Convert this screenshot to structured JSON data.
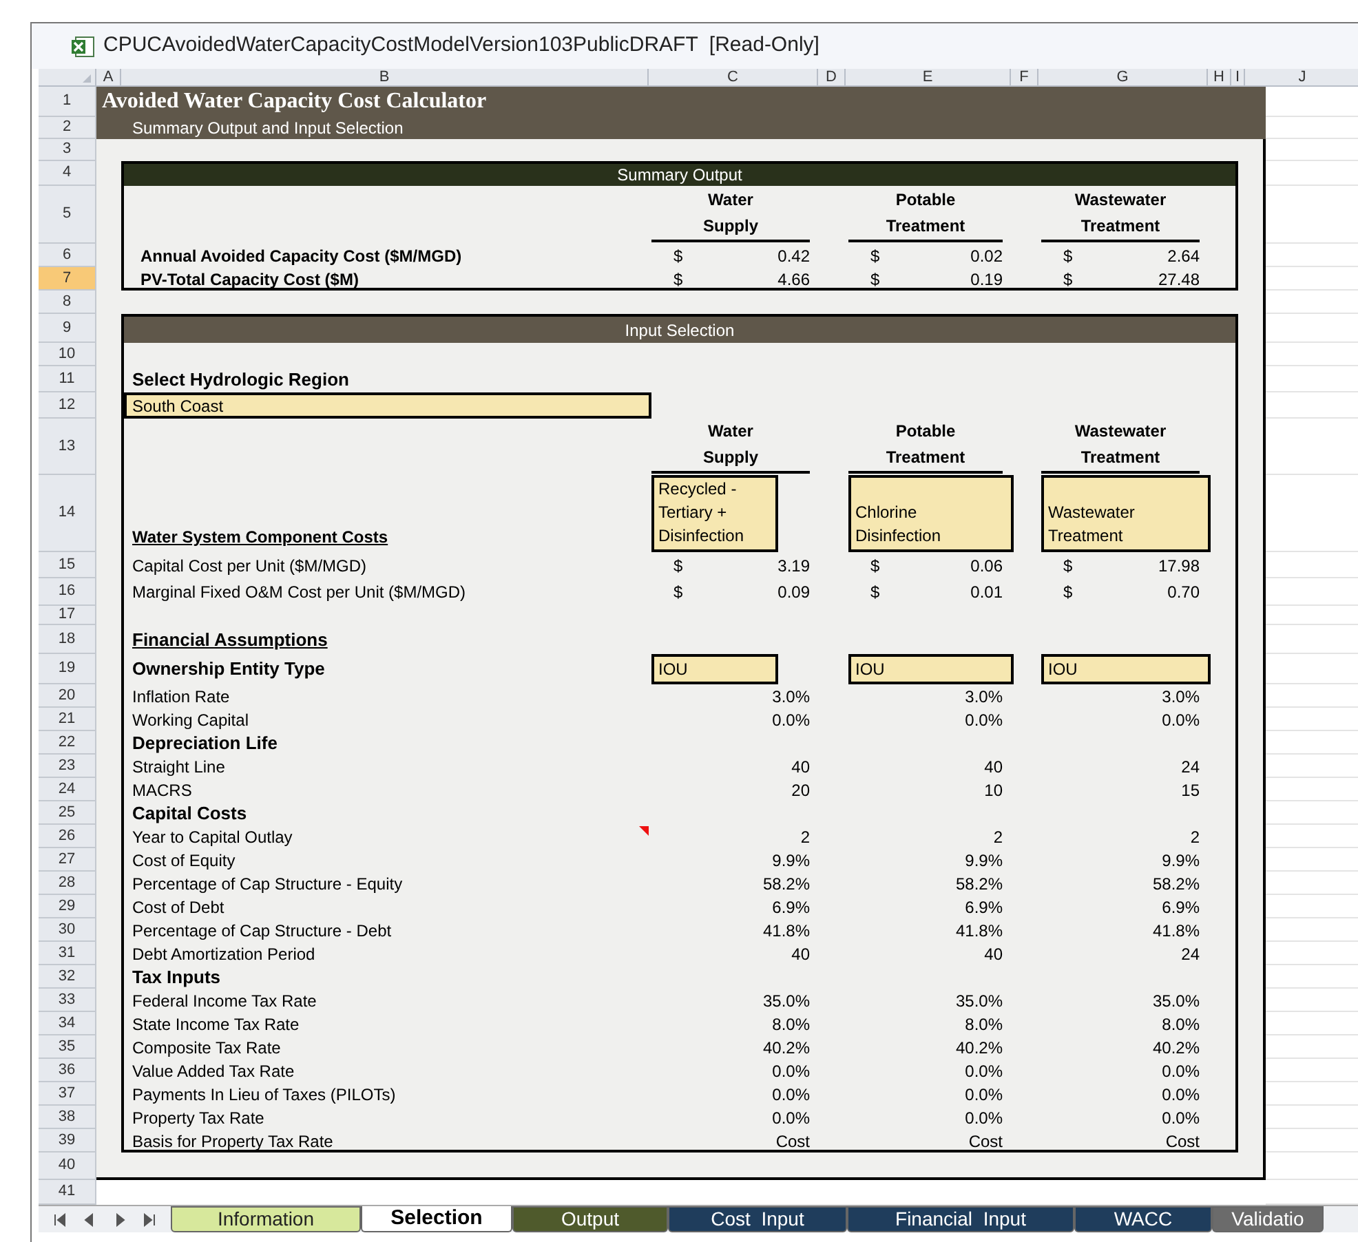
{
  "window": {
    "title": "CPUCAvoidedWaterCapacityCostModelVersion103PublicDRAFT  [Read-Only]"
  },
  "column_headers": [
    "A",
    "B",
    "C",
    "D",
    "E",
    "F",
    "G",
    "H",
    "I",
    "J"
  ],
  "row_headers": [
    {
      "label": "1",
      "selected": false
    },
    {
      "label": "2",
      "selected": false
    },
    {
      "label": "3",
      "selected": false
    },
    {
      "label": "4",
      "selected": false
    },
    {
      "label": "5",
      "selected": false
    },
    {
      "label": "6",
      "selected": false
    },
    {
      "label": "7",
      "selected": true
    },
    {
      "label": "8",
      "selected": false
    },
    {
      "label": "9",
      "selected": false
    },
    {
      "label": "10",
      "selected": false
    },
    {
      "label": "11",
      "selected": false
    },
    {
      "label": "12",
      "selected": false
    },
    {
      "label": "13",
      "selected": false
    },
    {
      "label": "14",
      "selected": false
    },
    {
      "label": "15",
      "selected": false
    },
    {
      "label": "16",
      "selected": false
    },
    {
      "label": "17",
      "selected": false
    },
    {
      "label": "18",
      "selected": false
    },
    {
      "label": "19",
      "selected": false
    },
    {
      "label": "20",
      "selected": false
    },
    {
      "label": "21",
      "selected": false
    },
    {
      "label": "22",
      "selected": false
    },
    {
      "label": "23",
      "selected": false
    },
    {
      "label": "24",
      "selected": false
    },
    {
      "label": "25",
      "selected": false
    },
    {
      "label": "26",
      "selected": false
    },
    {
      "label": "27",
      "selected": false
    },
    {
      "label": "28",
      "selected": false
    },
    {
      "label": "29",
      "selected": false
    },
    {
      "label": "30",
      "selected": false
    },
    {
      "label": "31",
      "selected": false
    },
    {
      "label": "32",
      "selected": false
    },
    {
      "label": "33",
      "selected": false
    },
    {
      "label": "34",
      "selected": false
    },
    {
      "label": "35",
      "selected": false
    },
    {
      "label": "36",
      "selected": false
    },
    {
      "label": "37",
      "selected": false
    },
    {
      "label": "38",
      "selected": false
    },
    {
      "label": "39",
      "selected": false
    },
    {
      "label": "40",
      "selected": false
    },
    {
      "label": "41",
      "selected": false
    }
  ],
  "sheet": {
    "title": "Avoided Water Capacity Cost Calculator",
    "subtitle": "Summary Output and Input Selection",
    "summary_output": {
      "title": "Summary Output",
      "column_headers": [
        {
          "line_1": "Water",
          "line_2": "Supply"
        },
        {
          "line_1": "Potable",
          "line_2": "Treatment"
        },
        {
          "line_1": "Wastewater",
          "line_2": "Treatment"
        }
      ],
      "rows": [
        {
          "label": "Annual Avoided Capacity Cost ($M/MGD)",
          "values": [
            {
              "currency": "$",
              "amount": "0.42"
            },
            {
              "currency": "$",
              "amount": "0.02"
            },
            {
              "currency": "$",
              "amount": "2.64"
            }
          ]
        },
        {
          "label": "PV-Total Capacity Cost ($M)",
          "values": [
            {
              "currency": "$",
              "amount": "4.66"
            },
            {
              "currency": "$",
              "amount": "0.19"
            },
            {
              "currency": "$",
              "amount": "27.48"
            }
          ]
        }
      ]
    },
    "input_selection": {
      "title": "Input Selection",
      "region_label": "Select Hydrologic Region",
      "region_value": "South Coast",
      "column_headers": [
        {
          "line_1": "Water",
          "line_2": "Supply"
        },
        {
          "line_1": "Potable",
          "line_2": "Treatment"
        },
        {
          "line_1": "Wastewater",
          "line_2": "Treatment"
        }
      ],
      "components_heading": "Water System Component Costs",
      "components": [
        {
          "lines": [
            "Recycled -",
            "Tertiary +",
            "Disinfection"
          ]
        },
        {
          "lines": [
            "Chlorine",
            "Disinfection"
          ]
        },
        {
          "lines": [
            "Wastewater",
            "Treatment"
          ]
        }
      ],
      "cost_rows": [
        {
          "label": "Capital Cost per Unit ($M/MGD)",
          "values": [
            {
              "currency": "$",
              "amount": "3.19"
            },
            {
              "currency": "$",
              "amount": "0.06"
            },
            {
              "currency": "$",
              "amount": "17.98"
            }
          ]
        },
        {
          "label": "Marginal Fixed O&M Cost per Unit ($M/MGD)",
          "values": [
            {
              "currency": "$",
              "amount": "0.09"
            },
            {
              "currency": "$",
              "amount": "0.01"
            },
            {
              "currency": "$",
              "amount": "0.70"
            }
          ]
        }
      ],
      "financial_heading": "Financial Assumptions",
      "ownership": {
        "label": "Ownership Entity Type",
        "values": [
          "IOU",
          "IOU",
          "IOU"
        ]
      },
      "assumptions": [
        {
          "kind": "value",
          "label": "Inflation Rate",
          "values": [
            "3.0%",
            "3.0%",
            "3.0%"
          ],
          "comment": false
        },
        {
          "kind": "value",
          "label": "Working Capital",
          "values": [
            "0.0%",
            "0.0%",
            "0.0%"
          ],
          "comment": false
        },
        {
          "kind": "heading",
          "label": "Depreciation Life"
        },
        {
          "kind": "value",
          "label": "Straight Line",
          "values": [
            "40",
            "40",
            "24"
          ],
          "comment": false
        },
        {
          "kind": "value",
          "label": "MACRS",
          "values": [
            "20",
            "10",
            "15"
          ],
          "comment": false
        },
        {
          "kind": "heading",
          "label": "Capital Costs"
        },
        {
          "kind": "value",
          "label": "Year to Capital Outlay",
          "values": [
            "2",
            "2",
            "2"
          ],
          "comment": true
        },
        {
          "kind": "value",
          "label": "Cost of Equity",
          "values": [
            "9.9%",
            "9.9%",
            "9.9%"
          ],
          "comment": false
        },
        {
          "kind": "value",
          "label": "Percentage of Cap Structure - Equity",
          "values": [
            "58.2%",
            "58.2%",
            "58.2%"
          ],
          "comment": false
        },
        {
          "kind": "value",
          "label": "Cost of Debt",
          "values": [
            "6.9%",
            "6.9%",
            "6.9%"
          ],
          "comment": false
        },
        {
          "kind": "value",
          "label": "Percentage of Cap Structure - Debt",
          "values": [
            "41.8%",
            "41.8%",
            "41.8%"
          ],
          "comment": false
        },
        {
          "kind": "value",
          "label": "Debt Amortization Period",
          "values": [
            "40",
            "40",
            "24"
          ],
          "comment": false
        },
        {
          "kind": "heading",
          "label": "Tax Inputs"
        },
        {
          "kind": "value",
          "label": "Federal Income Tax Rate",
          "values": [
            "35.0%",
            "35.0%",
            "35.0%"
          ],
          "comment": false
        },
        {
          "kind": "value",
          "label": "State Income Tax Rate",
          "values": [
            "8.0%",
            "8.0%",
            "8.0%"
          ],
          "comment": false
        },
        {
          "kind": "value",
          "label": "Composite Tax Rate",
          "values": [
            "40.2%",
            "40.2%",
            "40.2%"
          ],
          "comment": false
        },
        {
          "kind": "value",
          "label": "Value Added Tax Rate",
          "values": [
            "0.0%",
            "0.0%",
            "0.0%"
          ],
          "comment": false
        },
        {
          "kind": "value",
          "label": "Payments In Lieu of Taxes (PILOTs)",
          "values": [
            "0.0%",
            "0.0%",
            "0.0%"
          ],
          "comment": false
        },
        {
          "kind": "value",
          "label": "Property Tax Rate",
          "values": [
            "0.0%",
            "0.0%",
            "0.0%"
          ],
          "comment": false
        },
        {
          "kind": "value",
          "label": "Basis for Property Tax Rate",
          "values": [
            "Cost",
            "Cost",
            "Cost"
          ],
          "comment": false
        }
      ]
    }
  },
  "sheet_tabs": [
    {
      "label": "Information",
      "selected": false,
      "color": "#d7e89c"
    },
    {
      "label": "Selection",
      "selected": true,
      "color": "#ffffff"
    },
    {
      "label": "Output",
      "selected": false,
      "color": "#4f5a2c"
    },
    {
      "label": "Cost  Input",
      "selected": false,
      "color": "#1f3d5c"
    },
    {
      "label": "Financial  Input",
      "selected": false,
      "color": "#1f3d5c"
    },
    {
      "label": "WACC",
      "selected": false,
      "color": "#1f3d5c"
    },
    {
      "label": "Validatio",
      "selected": false,
      "color": "#6b6b6b"
    }
  ]
}
